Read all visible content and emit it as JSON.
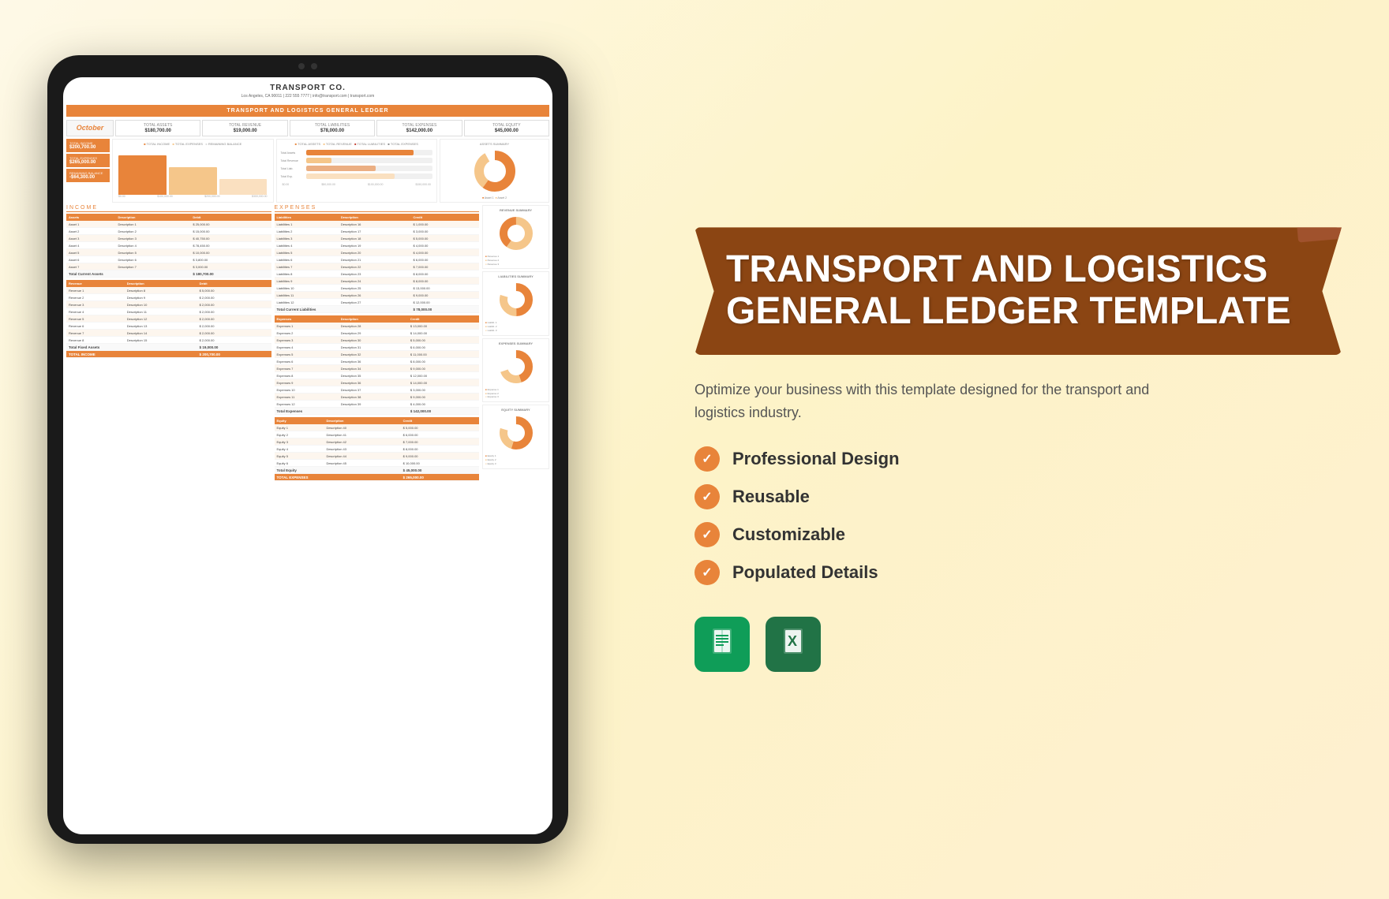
{
  "tablet": {
    "company": "TRANSPORT CO.",
    "address": "Los Angeles, CA 90011 | 222 555 7777 | info@transport.com | transport.com",
    "ledger_title": "TRANSPORT AND LOGISTICS GENERAL LEDGER",
    "month": "October",
    "summary": {
      "total_assets_label": "TOTAL ASSETS",
      "total_assets_value": "$180,700.00",
      "total_revenue_label": "TOTAL REVENUE",
      "total_revenue_value": "$19,000.00",
      "total_liabilities_label": "TOTAL LIABILITIES",
      "total_liabilities_value": "$78,000.00",
      "total_expenses_label": "TOTAL EXPENSES",
      "total_expenses_value": "$142,000.00",
      "total_equity_label": "TOTAL EQUITY",
      "total_equity_value": "$45,000.00"
    },
    "metrics": {
      "income_label": "TOTAL INCOME",
      "income_value": "$200,700.00",
      "expenses_label": "TOTAL EXPENSES",
      "expenses_value": "$265,000.00",
      "balance_label": "REMAINING BALANCE",
      "balance_value": "-$64,300.00"
    },
    "income_section": "INCOME",
    "expense_section": "EXPENSES"
  },
  "right": {
    "title_line1": "TRANSPORT AND LOGISTICS",
    "title_line2": "GENERAL LEDGER TEMPLATE",
    "description": "Optimize your business with this template designed for the transport and logistics industry.",
    "features": [
      "Professional Design",
      "Reusable",
      "Customizable",
      "Populated Details"
    ],
    "apps": [
      {
        "name": "Google Sheets",
        "letter": "目"
      },
      {
        "name": "Microsoft Excel",
        "letter": "X"
      }
    ]
  },
  "colors": {
    "orange": "#e8843a",
    "brown": "#8B4513",
    "dark_red": "#c0392b"
  }
}
